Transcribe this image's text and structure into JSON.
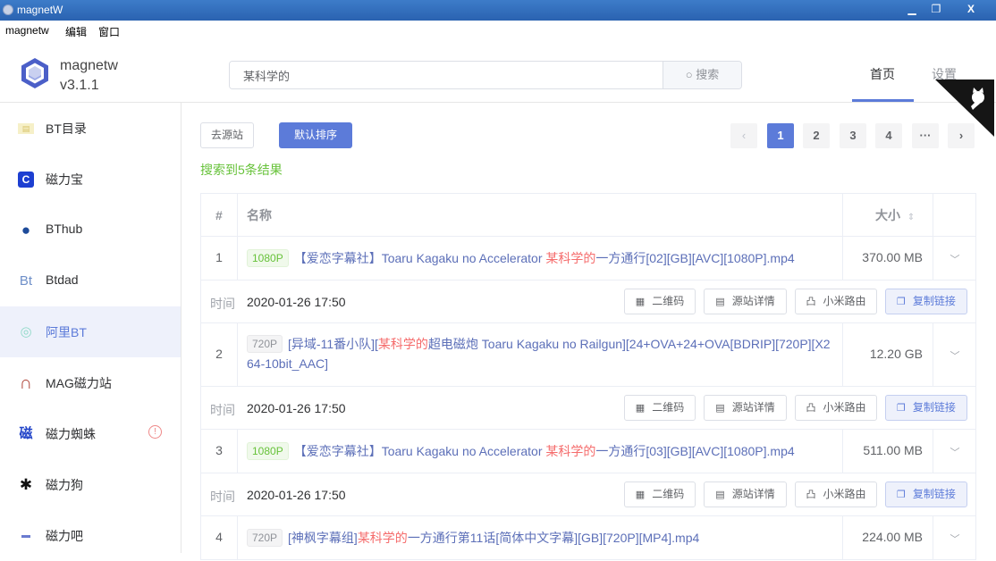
{
  "window": {
    "title": "magnetW",
    "minimize_icon": "minimize-icon",
    "maximize_icon": "restore-icon",
    "close_icon": "close-icon",
    "minimize_glyph": "▁",
    "maximize_glyph": "❐",
    "close_glyph": "X"
  },
  "menu": [
    "magnetw",
    "编辑",
    "窗口"
  ],
  "header": {
    "app_name": "magnetw",
    "version": "v3.1.1",
    "search": {
      "value": "某科学的",
      "placeholder": "",
      "button_label": "搜索",
      "button_icon_glyph": "○"
    },
    "nav": [
      {
        "label": "首页",
        "active": true
      },
      {
        "label": "设置",
        "active": false
      }
    ]
  },
  "sidebar": {
    "items": [
      {
        "label": "BT目录",
        "icon": "book-icon",
        "glyph": "▤",
        "color": "#d8c36a"
      },
      {
        "label": "磁力宝",
        "icon": "c-logo-icon",
        "glyph": "C",
        "color": "#1d3fd1"
      },
      {
        "label": "BThub",
        "icon": "globe-icon",
        "glyph": "●",
        "color": "#1e4b9a"
      },
      {
        "label": "Btdad",
        "icon": "bt-logo-icon",
        "glyph": "Bt",
        "color": "#6e8fc8"
      },
      {
        "label": "阿里BT",
        "icon": "alarm-icon",
        "glyph": "◎",
        "color": "#8fd9c8",
        "active": true
      },
      {
        "label": "MAG磁力站",
        "icon": "magnet-icon",
        "glyph": "∩",
        "color": "#b0473b"
      },
      {
        "label": "磁力蜘蛛",
        "icon": "ci-logo-icon",
        "glyph": "磁",
        "color": "#2446c9",
        "warning": "!"
      },
      {
        "label": "磁力狗",
        "icon": "dog-icon",
        "glyph": "✱",
        "color": "#111111"
      },
      {
        "label": "磁力吧",
        "icon": "ciliba-logo-icon",
        "glyph": "▬",
        "color": "#6a7bd0"
      }
    ]
  },
  "toolbar": {
    "source_button": "去源站",
    "sort_button": "默认排序",
    "result_text": "搜索到5条结果"
  },
  "pagination": {
    "prev": "‹",
    "pages": [
      "1",
      "2",
      "3",
      "4"
    ],
    "current": "1",
    "more": "···",
    "next": "›"
  },
  "table": {
    "columns": {
      "index": "#",
      "name": "名称",
      "size": "大小",
      "sort_glyph": "⇕"
    },
    "time_label": "时间",
    "actions": [
      {
        "label": "二维码",
        "icon": "qrcode-icon",
        "glyph": "▦"
      },
      {
        "label": "源站详情",
        "icon": "document-icon",
        "glyph": "▤"
      },
      {
        "label": "小米路由",
        "icon": "router-icon",
        "glyph": "凸"
      },
      {
        "label": "复制链接",
        "icon": "copy-icon",
        "glyph": "❐"
      }
    ],
    "expand_glyph": "﹀",
    "rows": [
      {
        "index": "1",
        "tag": "1080P",
        "name_pre": "【爱恋字幕社】Toaru Kagaku no Accelerator ",
        "name_hl": "某科学的",
        "name_post": "一方通行[02][GB][AVC][1080P].mp4",
        "size": "370.00 MB",
        "time": "2020-01-26 17:50",
        "expanded": true
      },
      {
        "index": "2",
        "tag": "720P",
        "name_pre": "[异域-11番小队][",
        "name_hl": "某科学的",
        "name_post": "超电磁炮 Toaru Kagaku no Railgun][24+OVA+24+OVA[BDRIP][720P][X264-10bit_AAC]",
        "size": "12.20 GB",
        "time": "2020-01-26 17:50",
        "expanded": true
      },
      {
        "index": "3",
        "tag": "1080P",
        "name_pre": "【爱恋字幕社】Toaru Kagaku no Accelerator ",
        "name_hl": "某科学的",
        "name_post": "一方通行[03][GB][AVC][1080P].mp4",
        "size": "511.00 MB",
        "time": "2020-01-26 17:50",
        "expanded": true
      },
      {
        "index": "4",
        "tag": "720P",
        "name_pre": "[神枫字幕组]",
        "name_hl": "某科学的",
        "name_post": "一方通行第11话[简体中文字幕][GB][720P][MP4].mp4",
        "size": "224.00 MB",
        "expanded": false
      }
    ]
  },
  "colors": {
    "accent": "#5c7bd9",
    "success": "#67c23a",
    "highlight": "#f56c6c",
    "link": "#5c6fb8"
  }
}
